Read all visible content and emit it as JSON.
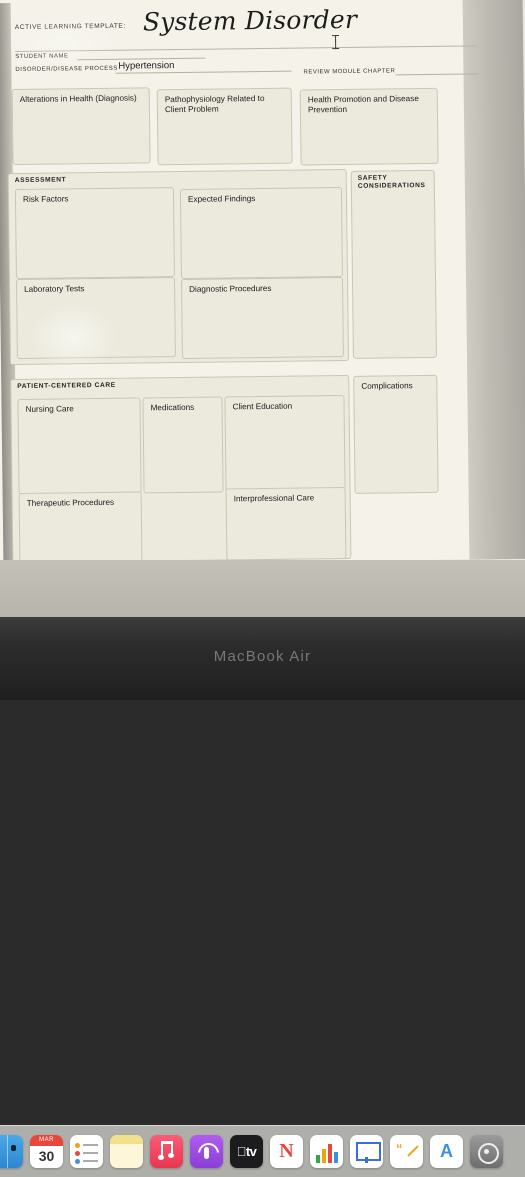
{
  "document": {
    "header": {
      "template_label": "ACTIVE LEARNING TEMPLATE:",
      "title": "System Disorder"
    },
    "fields": [
      {
        "label": "STUDENT NAME",
        "value": ""
      },
      {
        "label": "DISORDER/DISEASE PROCESS",
        "value": "Hypertension"
      },
      {
        "label": "REVIEW MODULE CHAPTER",
        "value": ""
      }
    ],
    "top_boxes": [
      {
        "title": "Alterations in Health (Diagnosis)"
      },
      {
        "title": "Pathophysiology Related to Client Problem"
      },
      {
        "title": "Health Promotion and Disease Prevention"
      }
    ],
    "sections": [
      {
        "band_title": "ASSESSMENT",
        "cells": [
          {
            "title": "Risk Factors"
          },
          {
            "title": "Expected Findings"
          },
          {
            "title": "Laboratory Tests"
          },
          {
            "title": "Diagnostic Procedures"
          }
        ]
      },
      {
        "band_title": "PATIENT-CENTERED CARE",
        "cells": [
          {
            "title": "Nursing Care"
          },
          {
            "title": "Medications"
          },
          {
            "title": "Client Education"
          },
          {
            "title": "Therapeutic Procedures"
          },
          {
            "title": "Interprofessional Care"
          }
        ]
      }
    ],
    "side_column": {
      "safety_title": "SAFETY CONSIDERATIONS",
      "complications_title": "Complications"
    }
  },
  "dock": {
    "items": [
      {
        "name": "finder-icon",
        "label": "Finder"
      },
      {
        "name": "calendar-icon",
        "label": "Calendar",
        "month": "MAR",
        "day": "30"
      },
      {
        "name": "reminders-icon",
        "label": "Reminders"
      },
      {
        "name": "notes-icon",
        "label": "Notes"
      },
      {
        "name": "music-icon",
        "label": "Music"
      },
      {
        "name": "podcasts-icon",
        "label": "Podcasts"
      },
      {
        "name": "apple-tv-icon",
        "label": "TV"
      },
      {
        "name": "news-icon",
        "label": "News"
      },
      {
        "name": "numbers-icon",
        "label": "Numbers"
      },
      {
        "name": "keynote-icon",
        "label": "Keynote"
      },
      {
        "name": "pages-icon",
        "label": "Pages"
      },
      {
        "name": "app-store-icon",
        "label": "App Store"
      },
      {
        "name": "settings-icon",
        "label": "System Settings"
      }
    ]
  },
  "device": {
    "brand_label": "MacBook Air"
  },
  "colors": {
    "paper": "#f4f2e9",
    "box_fill": "#eceadd",
    "box_border": "#c9c7b4",
    "calendar_red": "#e8483b"
  }
}
